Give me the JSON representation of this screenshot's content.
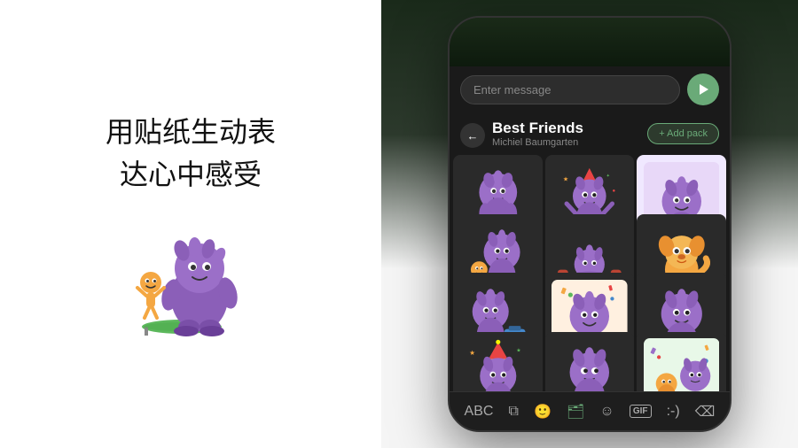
{
  "left": {
    "title_line1": "用贴纸生动表",
    "title_line2": "达心中感受"
  },
  "phone": {
    "message_placeholder": "Enter message",
    "pack_title": "Best Friends",
    "pack_author": "Michiel Baumgarten",
    "add_pack_label": "+ Add pack",
    "back_label": "←",
    "keyboard_items": [
      "ABC",
      "🔄",
      "😊",
      "🗂",
      "🙂",
      "GIF",
      ":-)",
      "⌫"
    ]
  }
}
